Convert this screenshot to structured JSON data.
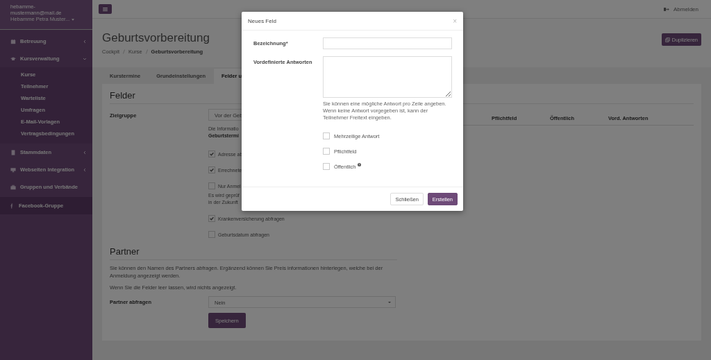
{
  "sidebar": {
    "user_email": "hebamme-mustermann@mail.de",
    "user_name": "Hebamme Petra Muster...",
    "items": [
      {
        "label": "Betreuung",
        "expanded": false,
        "has_children": true,
        "selected": false
      },
      {
        "label": "Kursverwaltung",
        "expanded": true,
        "has_children": true,
        "selected": false,
        "children": [
          {
            "label": "Kurse"
          },
          {
            "label": "Teilnehmer"
          },
          {
            "label": "Warteliste"
          },
          {
            "label": "Umfragen"
          },
          {
            "label": "E-Mail-Vorlagen"
          },
          {
            "label": "Vertragsbedingungen"
          }
        ]
      },
      {
        "label": "Stammdaten",
        "expanded": false,
        "has_children": true,
        "selected": false
      },
      {
        "label": "Webseiten Integration",
        "expanded": false,
        "has_children": true,
        "selected": false
      },
      {
        "label": "Gruppen und Verbände",
        "has_children": false,
        "selected": false
      },
      {
        "label": "Facebook-Gruppe",
        "has_children": false,
        "selected": true
      }
    ]
  },
  "topbar": {
    "logout": "Abmelden"
  },
  "header": {
    "title": "Geburtsvorbereitung",
    "breadcrumb": [
      {
        "label": "Cockpit",
        "current": false
      },
      {
        "label": "Kurse",
        "current": false
      },
      {
        "label": "Geburtsvorbereitung",
        "current": true
      }
    ],
    "duplicate_button": "Duplizieren"
  },
  "tabs": [
    {
      "label": "Kurstermine",
      "selected": false
    },
    {
      "label": "Grundeinstellungen",
      "selected": false
    },
    {
      "label": "Felder u",
      "selected": true
    }
  ],
  "felder": {
    "heading": "Felder",
    "zielgruppe_label": "Zielgruppe",
    "zielgruppe_value": "Vor der Geb",
    "info_lines": [
      "Die Informatio",
      "Geburtstermi"
    ],
    "options": [
      {
        "label": "Adresse ab",
        "checked": true
      },
      {
        "label": "Errechnete",
        "checked": true
      },
      {
        "label": "Nur Anmel",
        "checked": false,
        "help": [
          "Es wird geprüf",
          "in der Zukunft"
        ]
      },
      {
        "label": "Krankenversicherung abfragen",
        "checked": true
      },
      {
        "label": "Geburtsdatum abfragen",
        "checked": false
      }
    ],
    "table_columns": [
      "Pflichtfeld",
      "Öffentlich",
      "Vord. Antworten"
    ]
  },
  "partner": {
    "heading": "Partner",
    "texts": [
      "Sie können den Namen des Partners abfragen. Ergänzend können Sie Preis informationen hinterlegen, welche bei der Anmeldung angezeigt werden.",
      "Wenn Sie die Felder leer lassen, wird nichts angezeigt."
    ],
    "label": "Partner abfragen",
    "value": "Nein",
    "save_button": "Speichern"
  },
  "modal": {
    "title": "Neues Feld",
    "close": "×",
    "name_label": "Bezeichnung*",
    "answers_label": "Vordefinierte Antworten",
    "answers_help": "Sie können eine mögliche Antwort pro Zeile angeben. Wenn keine Antwort vorgegeben ist, kann der Teilnehmer Freitext eingeben.",
    "checkboxes": [
      {
        "label": "Mehrzeilige Antwort",
        "checked": false,
        "help_icon": false
      },
      {
        "label": "Pflichtfeld",
        "checked": false,
        "help_icon": false
      },
      {
        "label": "Öffentlich",
        "checked": false,
        "help_icon": true
      }
    ],
    "buttons": [
      {
        "label": "Schließen",
        "kind": "default"
      },
      {
        "label": "Erstellen",
        "kind": "primary"
      }
    ]
  }
}
